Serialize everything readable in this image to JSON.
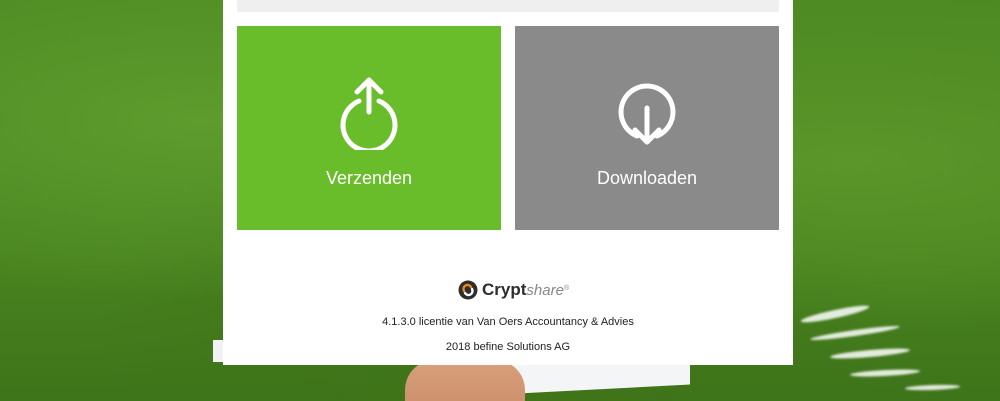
{
  "tiles": {
    "send_label": "Verzenden",
    "download_label": "Downloaden"
  },
  "brand": {
    "name_strong": "Crypt",
    "name_light": "share",
    "registered": "®"
  },
  "footer": {
    "license": "4.1.3.0 licentie van Van Oers Accountancy & Advies",
    "copyright": "2018 befine Solutions AG"
  },
  "colors": {
    "send_tile": "#6abd2a",
    "download_tile": "#8a8a8a",
    "background": "#4f8a24",
    "logo_orange": "#e78a1c"
  }
}
